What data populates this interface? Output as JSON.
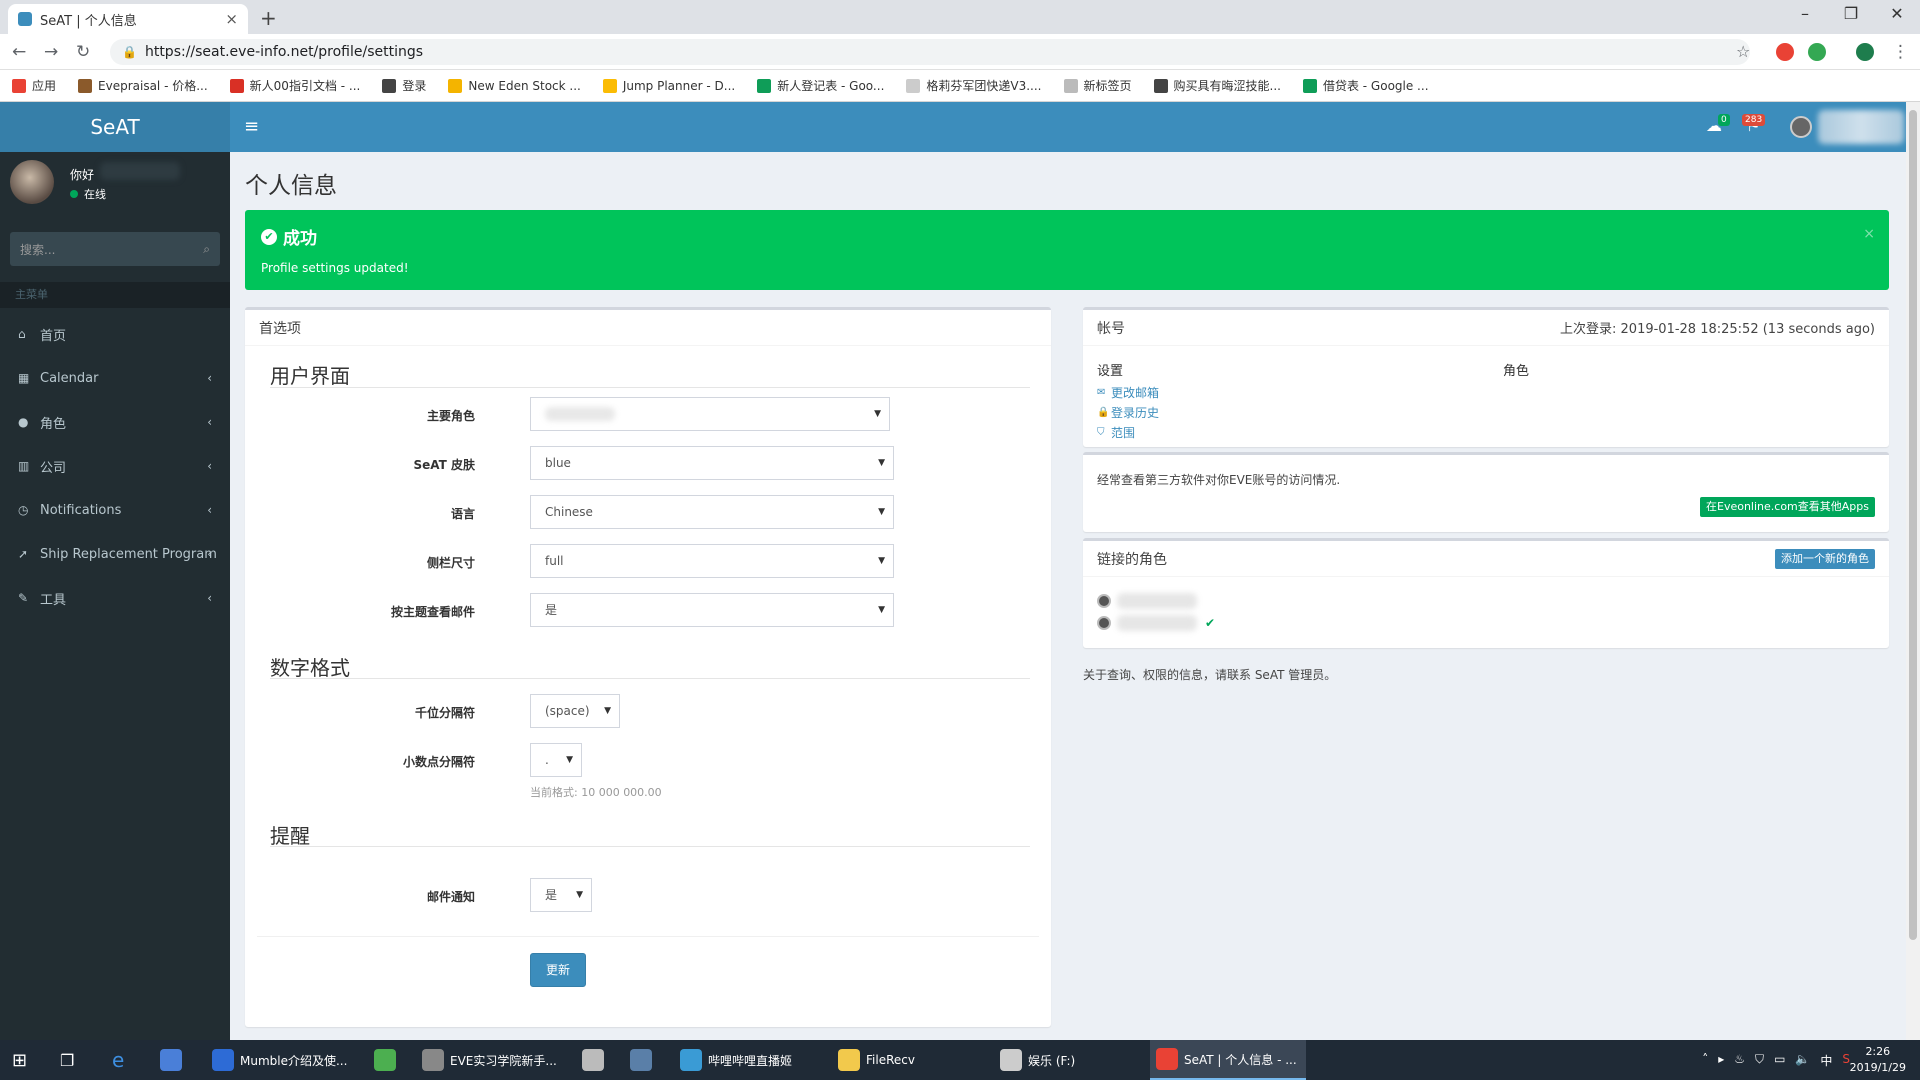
{
  "browser": {
    "tab_title": "SeAT | 个人信息",
    "tab_close": "×",
    "new_tab": "+",
    "url": "https://seat.eve-info.net/profile/settings",
    "window_controls": {
      "minimize": "–",
      "restore": "❐",
      "close": "✕"
    },
    "bookmarks": [
      {
        "label": "应用",
        "color": "#e94235"
      },
      {
        "label": "Evepraisal - 价格...",
        "color": "#8b5a2b"
      },
      {
        "label": "新人00指引文档 - ...",
        "color": "#d93025"
      },
      {
        "label": "登录",
        "color": "#444444"
      },
      {
        "label": "New Eden Stock ...",
        "color": "#f4b400"
      },
      {
        "label": "Jump Planner - D...",
        "color": "#fbbc04"
      },
      {
        "label": "新人登记表 - Goo...",
        "color": "#0f9d58"
      },
      {
        "label": "格莉芬军团快递V3....",
        "color": "#cccccc"
      },
      {
        "label": "新标签页",
        "color": "#bbbbbb"
      },
      {
        "label": "购买具有晦涩技能...",
        "color": "#444444"
      },
      {
        "label": "借贷表 - Google ...",
        "color": "#0f9d58"
      }
    ]
  },
  "header": {
    "logo": "SeAT",
    "toggle": "≡",
    "notif_badge_1": "0",
    "notif_badge_2": "283"
  },
  "sidebar": {
    "user_greeting": "你好",
    "user_status": "在线",
    "search_placeholder": "搜索...",
    "section_header": "主菜单",
    "items": [
      {
        "label": "首页",
        "icon": "home-icon",
        "glyph": "⌂"
      },
      {
        "label": "Calendar",
        "icon": "calendar-icon",
        "glyph": "▦"
      },
      {
        "label": "角色",
        "icon": "user-icon",
        "glyph": "●"
      },
      {
        "label": "公司",
        "icon": "building-icon",
        "glyph": "▥"
      },
      {
        "label": "Notifications",
        "icon": "bell-icon",
        "glyph": "◷"
      },
      {
        "label": "Ship Replacement Program",
        "icon": "rocket-icon",
        "glyph": "➚"
      },
      {
        "label": "工具",
        "icon": "wrench-icon",
        "glyph": "✎"
      }
    ]
  },
  "page": {
    "title": "个人信息",
    "alert": {
      "title": "成功",
      "message": "Profile settings updated!",
      "close": "×"
    }
  },
  "preferences": {
    "header": "首选项",
    "ui_section": "用户界面",
    "main_character_label": "主要角色",
    "main_character_value": "",
    "skin_label": "SeAT 皮肤",
    "skin_value": "blue",
    "language_label": "语言",
    "language_value": "Chinese",
    "sidebar_size_label": "侧栏尺寸",
    "sidebar_size_value": "full",
    "mail_threads_label": "按主题查看邮件",
    "mail_threads_value": "是",
    "number_section": "数字格式",
    "thousand_sep_label": "千位分隔符",
    "thousand_sep_value": "(space)",
    "decimal_sep_label": "小数点分隔符",
    "decimal_sep_value": ".",
    "format_help": "当前格式: 10 000 000.00",
    "reminder_section": "提醒",
    "mail_notify_label": "邮件通知",
    "mail_notify_value": "是",
    "submit": "更新"
  },
  "account": {
    "header": "帐号",
    "last_login": "上次登录: 2019-01-28 18:25:52 (13 seconds ago)",
    "settings_col": "设置",
    "roles_col": "角色",
    "links": [
      "更改邮箱",
      "登录历史",
      "范围"
    ],
    "third_party_text": "经常查看第三方软件对你EVE账号的访问情况.",
    "third_party_button": "在Eveonline.com查看其他Apps"
  },
  "linked": {
    "header": "链接的角色",
    "add_button": "添加一个新的角色",
    "check": "✔"
  },
  "footer_note": "关于查询、权限的信息，请联系 SeAT 管理员。",
  "taskbar": {
    "items": [
      {
        "label": "Mumble介绍及使...",
        "color": "#2d6bd6"
      },
      {
        "label": "",
        "color": "#4caf50"
      },
      {
        "label": "EVE实习学院新手...",
        "color": "#888888"
      },
      {
        "label": "",
        "color": "#bbbbbb"
      },
      {
        "label": "",
        "color": "#5a7fa8"
      },
      {
        "label": "哔哩哔哩直播姬",
        "color": "#3a9bd5"
      },
      {
        "label": "FileRecv",
        "color": "#f2c94c"
      },
      {
        "label": "娱乐 (F:)",
        "color": "#cccccc"
      },
      {
        "label": "SeAT | 个人信息 - ...",
        "color": "#e94235"
      }
    ],
    "ime": "中",
    "time": "2:26",
    "date": "2019/1/29"
  }
}
